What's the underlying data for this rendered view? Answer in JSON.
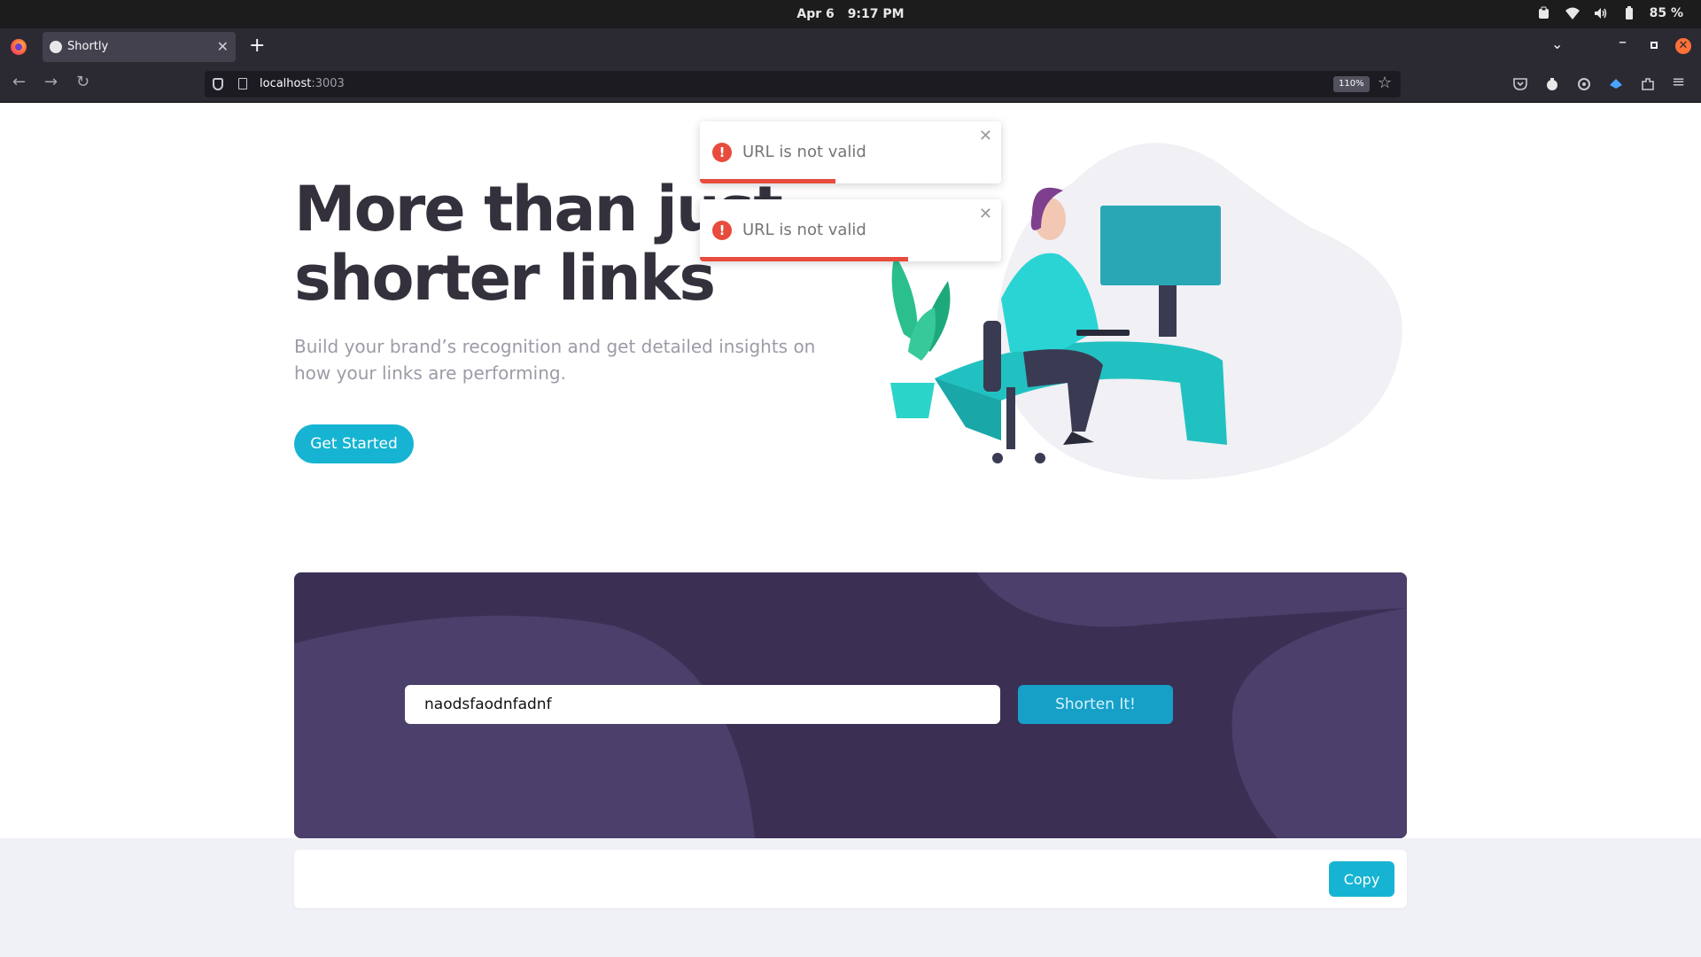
{
  "os": {
    "date": "Apr 6",
    "time": "9:17 PM",
    "battery": "85 %"
  },
  "browser": {
    "tab_title": "Shortly",
    "url_host": "localhost",
    "url_port": ":3003",
    "zoom": "110%"
  },
  "toasts": [
    {
      "message": "URL is not valid",
      "progress": 0.45
    },
    {
      "message": "URL is not valid",
      "progress": 0.69
    }
  ],
  "hero": {
    "title_line1": "More than just",
    "title_line2": "shorter links",
    "subtitle": "Build your brand’s recognition and get detailed insights on how your links are performing.",
    "cta": "Get Started"
  },
  "shorten": {
    "input_value": "naodsfaodnfadnf",
    "button": "Shorten It!"
  },
  "result": {
    "copy_button": "Copy"
  },
  "colors": {
    "primary": "#16b4d2",
    "panel": "#3b3054",
    "error": "#e74c3c",
    "heading": "#34313d",
    "muted": "#9e9aa7"
  }
}
